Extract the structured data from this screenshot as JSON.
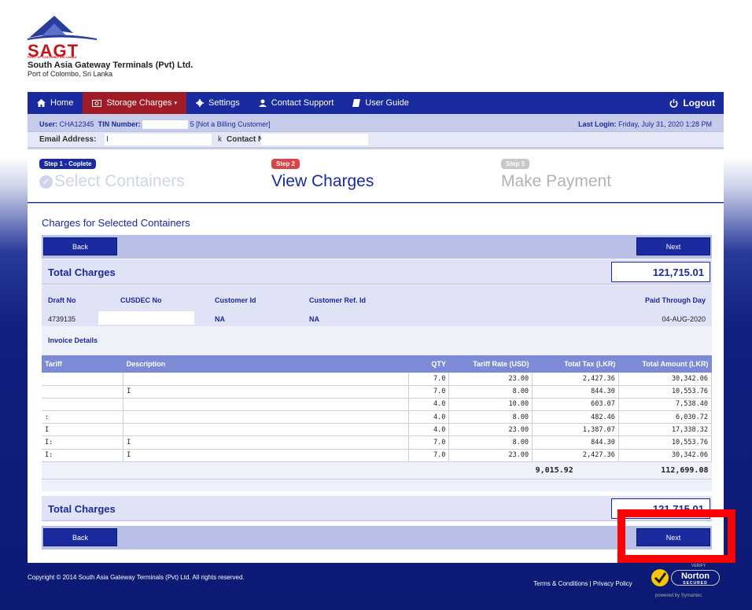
{
  "brand": {
    "logo_text": "SAGT",
    "logo_sub": "PORT OF COLOMBO SRI LANKA",
    "company": "South Asia Gateway Terminals (Pvt) Ltd.",
    "company_sub": "Port of Colombo, Sri Lanka"
  },
  "nav": {
    "home": "Home",
    "storage": "Storage Charges",
    "settings": "Settings",
    "support": "Contact Support",
    "guide": "User Guide",
    "logout": "Logout"
  },
  "user_info": {
    "user_label": "User:",
    "user_value": "CHA12345",
    "tin_label": "TIN Number:",
    "tin_suffix": "5 [Not a Billing Customer]",
    "last_login_label": "Last Login:",
    "last_login_value": "Friday, July 31, 2020 1:28 PM",
    "email_label": "Email Address:",
    "email_fragment": "I",
    "contact_prefix": "k",
    "contact_label": "Contact No.:"
  },
  "steps": [
    {
      "badge": "Step 1 - Coplete",
      "title": "Select Containers"
    },
    {
      "badge": "Step 2",
      "title": "View Charges"
    },
    {
      "badge": "Step 3",
      "title": "Make Payment"
    }
  ],
  "section_title": "Charges for Selected Containers",
  "buttons": {
    "back": "Back",
    "next": "Next"
  },
  "total": {
    "label": "Total Charges",
    "value": "121,715.01",
    "value_bottom": "121,715.01"
  },
  "meta": {
    "headers": [
      "Draft No",
      "CUSDEC No",
      "Customer Id",
      "Customer Ref. Id",
      "Paid Through Day"
    ],
    "values": {
      "draft": "4739135",
      "customer_id": "NA",
      "customer_ref": "NA",
      "paid_through": "04-AUG-2020"
    }
  },
  "invoice": {
    "title": "Invoice Details",
    "columns": [
      "Tariff",
      "Description",
      "QTY",
      "Tariff Rate (USD)",
      "Total Tax (LKR)",
      "Total Amount (LKR)"
    ],
    "rows": [
      {
        "tariff": "",
        "desc": "",
        "qty": "7.0",
        "rate": "23.00",
        "tax": "2,427.36",
        "amount": "30,342.06"
      },
      {
        "tariff": "",
        "desc": "I",
        "qty": "7.0",
        "rate": "8.00",
        "tax": "844.30",
        "amount": "10,553.76"
      },
      {
        "tariff": "",
        "desc": "",
        "qty": "4.0",
        "rate": "10.00",
        "tax": "603.07",
        "amount": "7,538.40"
      },
      {
        "tariff": ":",
        "desc": "",
        "qty": "4.0",
        "rate": "8.00",
        "tax": "482.46",
        "amount": "6,030.72"
      },
      {
        "tariff": "I",
        "desc": "",
        "qty": "4.0",
        "rate": "23.00",
        "tax": "1,387.07",
        "amount": "17,338.32"
      },
      {
        "tariff": "I:",
        "desc": "I",
        "qty": "7.0",
        "rate": "8.00",
        "tax": "844.30",
        "amount": "10,553.76"
      },
      {
        "tariff": "I:",
        "desc": "I",
        "qty": "7.0",
        "rate": "23.00",
        "tax": "2,427.36",
        "amount": "30,342.06"
      }
    ],
    "sum_tax": "9,015.92",
    "sum_amount": "112,699.08"
  },
  "footer": {
    "copyright": "Copyright © 2014 South Asia Gateway Terminals (Pvt) Ltd. All rights reserved.",
    "links": "Terms & Conditions | Privacy Policy",
    "norton_verify": "VERIFY",
    "norton_text": "Norton",
    "norton_secured": "SECURED",
    "norton_powered": "powered by Symantec"
  },
  "colors": {
    "nav": "#1a2a9f",
    "active_tab": "#a01b25",
    "highlight": "#ff0000"
  }
}
